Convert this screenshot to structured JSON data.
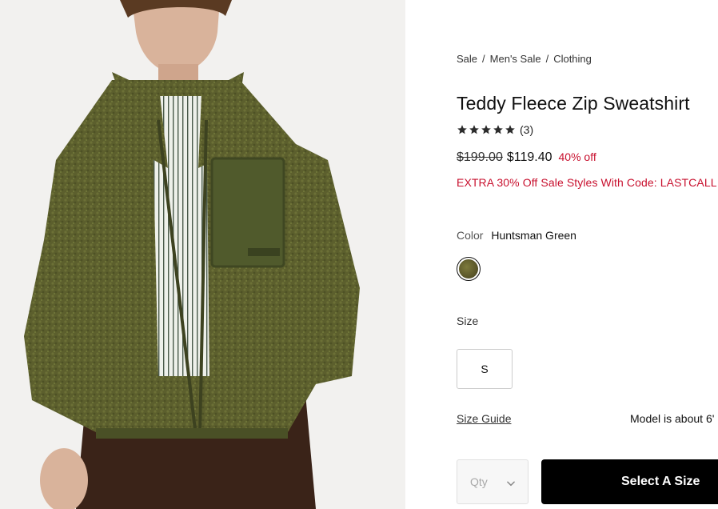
{
  "breadcrumb": {
    "items": [
      "Sale",
      "Men's Sale",
      "Clothing"
    ],
    "separator": "/"
  },
  "product": {
    "title": "Teddy Fleece Zip Sweatshirt",
    "rating": {
      "stars": 5,
      "count_text": "(3)"
    },
    "price": {
      "original": "$199.00",
      "sale": "$119.40",
      "discount": "40% off"
    },
    "promo": "EXTRA 30% Off Sale Styles With Code: LASTCALL",
    "color": {
      "label": "Color",
      "value": "Huntsman Green",
      "swatch_color": "#5e5a2b"
    },
    "size": {
      "label": "Size",
      "options": [
        "S"
      ]
    },
    "size_guide": "Size Guide",
    "model_info": "Model is about 6'"
  },
  "purchase": {
    "qty_placeholder": "Qty",
    "cta_label": "Select A Size"
  },
  "colors": {
    "promo_red": "#c8102e",
    "cta_bg": "#000000",
    "jacket_green": "#5b5f2e"
  }
}
